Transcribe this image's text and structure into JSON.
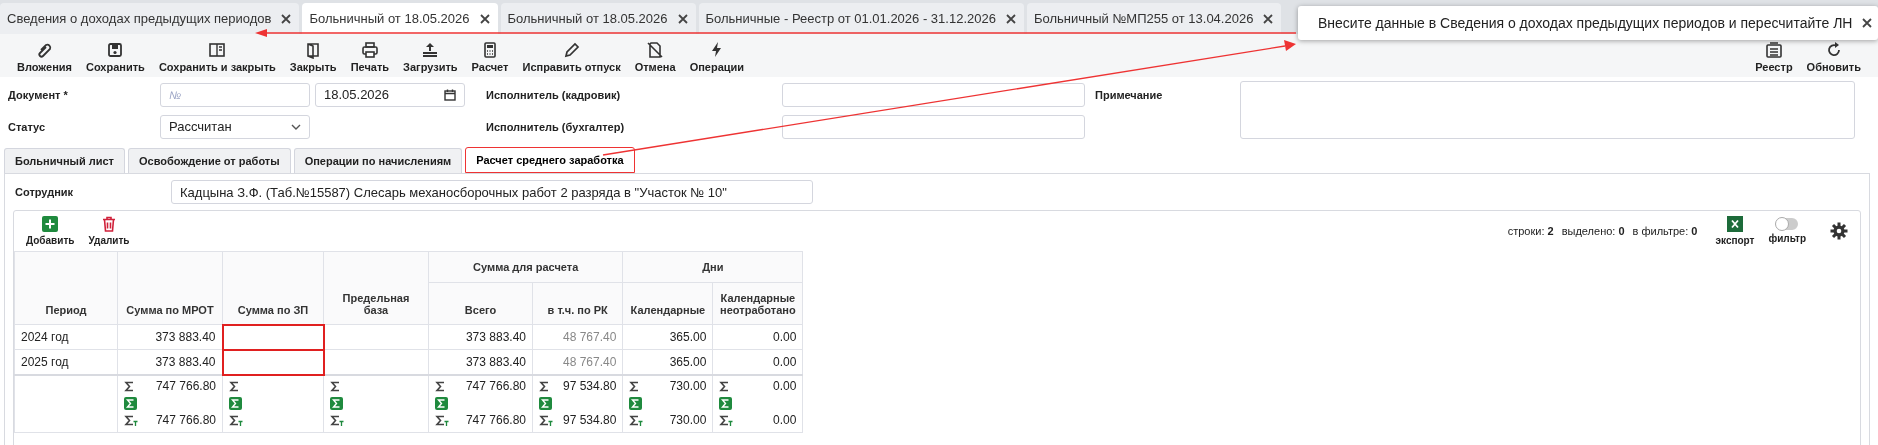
{
  "tabs": [
    {
      "label": "Сведения о доходах предыдущих периодов",
      "selected": false
    },
    {
      "label": "Больничный от 18.05.2026",
      "selected": true
    },
    {
      "label": "Больничный от 18.05.2026",
      "selected": false
    },
    {
      "label": "Больничные - Реестр от 01.01.2026 - 31.12.2026",
      "selected": false
    },
    {
      "label": "Больничный №МП255 от 13.04.2026",
      "selected": false
    }
  ],
  "toast": {
    "text": "Внесите данные в Сведения о доходах предыдущих периодов и пересчитайте ЛН"
  },
  "toolbar": [
    {
      "kind": "attach",
      "label": "Вложения"
    },
    {
      "kind": "save",
      "label": "Сохранить"
    },
    {
      "kind": "saveclose",
      "label": "Сохранить и закрыть"
    },
    {
      "kind": "close",
      "label": "Закрыть"
    },
    {
      "kind": "print",
      "label": "Печать"
    },
    {
      "kind": "upload",
      "label": "Загрузить"
    },
    {
      "kind": "calc",
      "label": "Расчет"
    },
    {
      "kind": "edit",
      "label": "Исправить отпуск"
    },
    {
      "kind": "cancel",
      "label": "Отмена"
    },
    {
      "kind": "ops",
      "label": "Операции"
    }
  ],
  "toolbar_right": [
    {
      "kind": "registry",
      "label": "Реестр"
    },
    {
      "kind": "refresh",
      "label": "Обновить"
    }
  ],
  "form": {
    "document_label": "Документ *",
    "document_placeholder": "№",
    "date": "18.05.2026",
    "status_label": "Статус",
    "status_value": "Рассчитан",
    "executor_hr_label": "Исполнитель (кадровик)",
    "executor_acc_label": "Исполнитель (бухгалтер)",
    "note_label": "Примечание"
  },
  "subtabs": [
    {
      "label": "Больничный лист",
      "selected": false
    },
    {
      "label": "Освобождение от работы",
      "selected": false
    },
    {
      "label": "Операции по начислениям",
      "selected": false
    },
    {
      "label": "Расчет среднего заработка",
      "selected": true
    }
  ],
  "employee": {
    "label": "Сотрудник",
    "value": "Кадцына З.Ф. (Таб.№15587) Слесарь механосборочных работ 2 разряда в \"Участок № 10\""
  },
  "grid": {
    "add_label": "Добавить",
    "delete_label": "Удалить",
    "stats": [
      {
        "label": "строки:",
        "value": "2"
      },
      {
        "label": "выделено:",
        "value": "0"
      },
      {
        "label": "в фильтре:",
        "value": "0"
      }
    ],
    "export_label": "экспорт",
    "filter_label": "фильтр",
    "filter_on": false,
    "header": [
      {
        "kind": "single",
        "label": "Период"
      },
      {
        "kind": "single",
        "label": "Сумма по МРОТ"
      },
      {
        "kind": "single",
        "label": "Сумма по ЗП"
      },
      {
        "kind": "single",
        "label": "Предельная база"
      },
      {
        "kind": "group",
        "label": "Сумма для расчета",
        "columns": [
          "Всего",
          "в т.ч. по РК"
        ]
      },
      {
        "kind": "group",
        "label": "Дни",
        "columns": [
          "Календарные",
          "Календарные неотработано"
        ]
      }
    ],
    "rows": [
      {
        "cells": [
          {
            "text": "2024 год",
            "muted": false,
            "flagged": false
          },
          {
            "text": "373 883.40",
            "muted": false,
            "flagged": false
          },
          {
            "flagged": true
          },
          {
            "flagged": false
          },
          {
            "text": "373 883.40",
            "muted": false,
            "flagged": false
          },
          {
            "text": "48 767.40",
            "muted": true,
            "flagged": false
          },
          {
            "text": "365.00",
            "muted": false,
            "flagged": false
          },
          {
            "text": "0.00",
            "muted": false,
            "flagged": false
          }
        ]
      },
      {
        "cells": [
          {
            "text": "2025 год",
            "muted": false,
            "flagged": false
          },
          {
            "text": "373 883.40",
            "muted": false,
            "flagged": false
          },
          {
            "flagged": true
          },
          {
            "flagged": false
          },
          {
            "text": "373 883.40",
            "muted": false,
            "flagged": false
          },
          {
            "text": "48 767.40",
            "muted": true,
            "flagged": false
          },
          {
            "text": "365.00",
            "muted": false,
            "flagged": false
          },
          {
            "text": "0.00",
            "muted": false,
            "flagged": false
          }
        ]
      }
    ],
    "totals": [
      {
        "kind": "values",
        "sum": "747 766.80",
        "filtered_sum": "747 766.80"
      },
      {
        "kind": "empty"
      },
      {
        "kind": "empty"
      },
      {
        "kind": "values",
        "sum": "747 766.80",
        "filtered_sum": "747 766.80"
      },
      {
        "kind": "values",
        "sum": "97 534.80",
        "filtered_sum": "97 534.80"
      },
      {
        "kind": "values",
        "sum": "730.00",
        "filtered_sum": "730.00"
      },
      {
        "kind": "values",
        "sum": "0.00",
        "filtered_sum": "0.00"
      }
    ]
  }
}
